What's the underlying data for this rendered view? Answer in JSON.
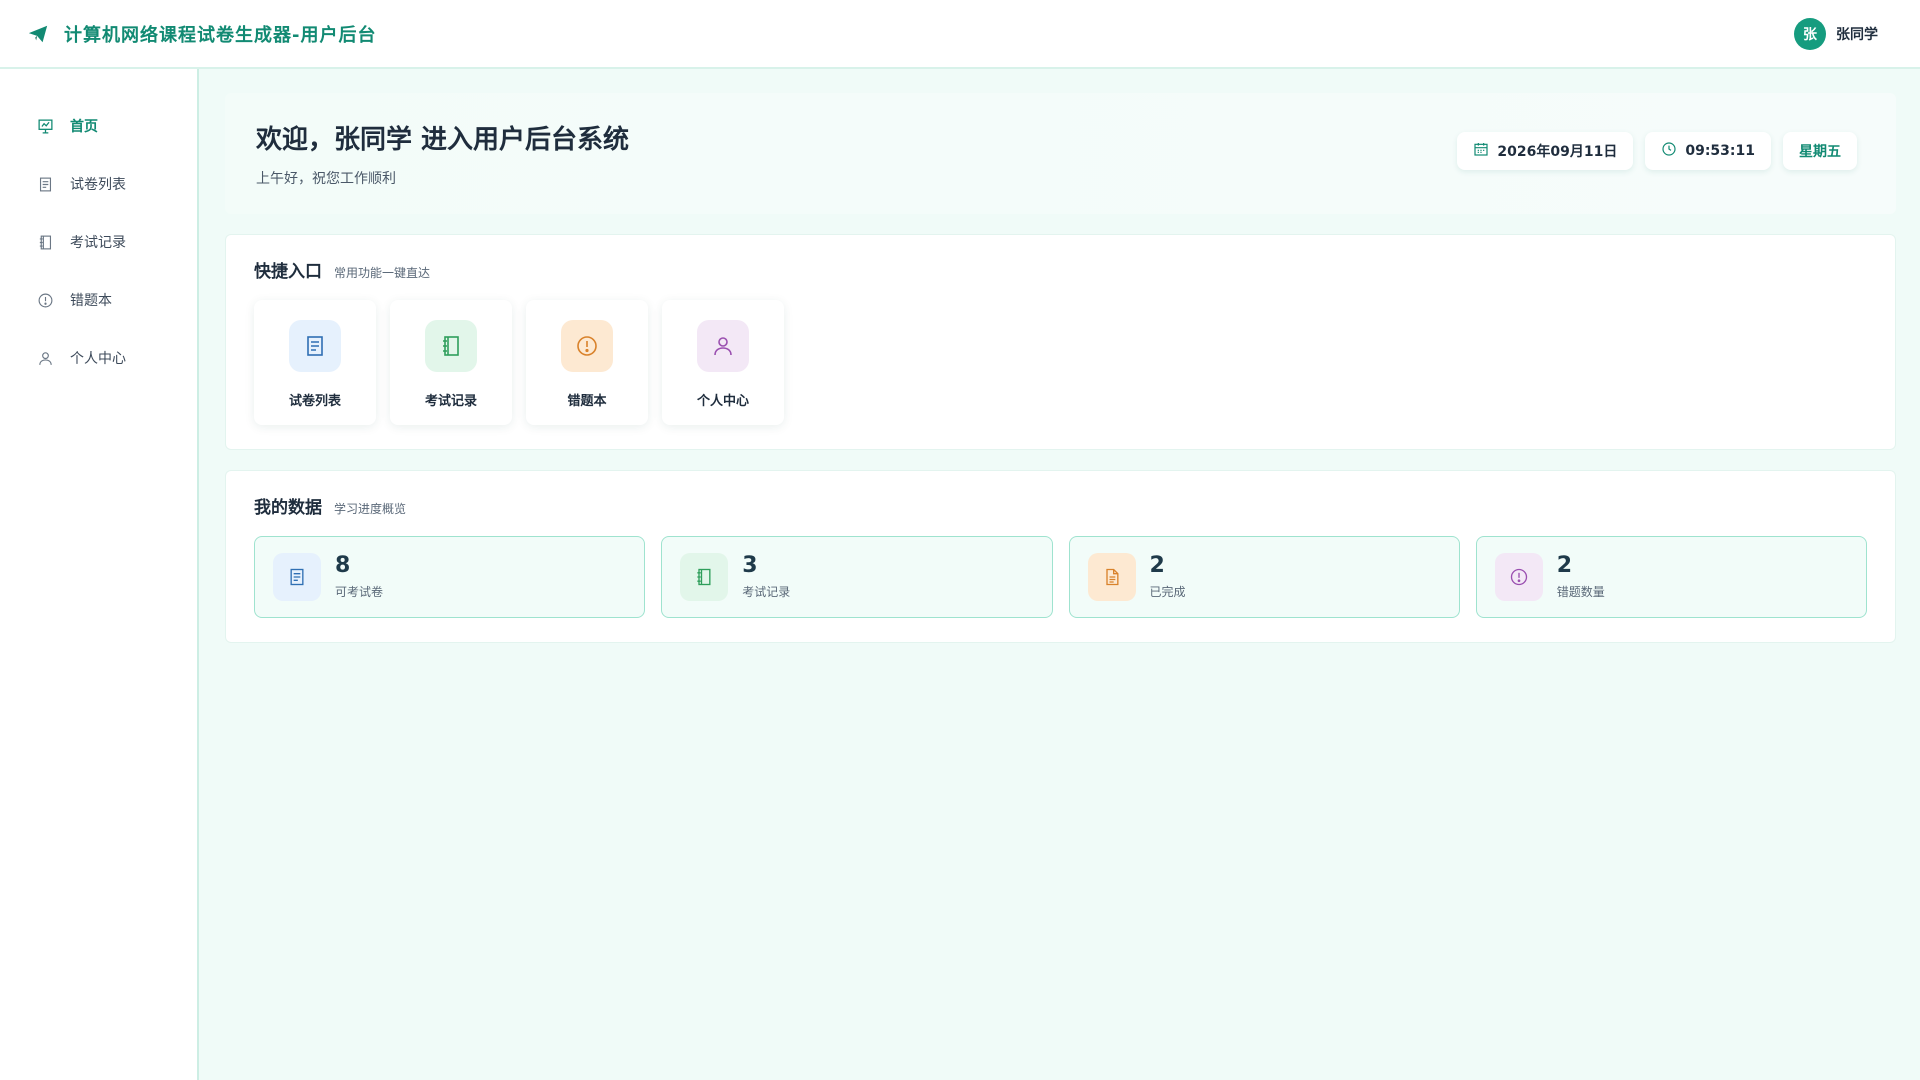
{
  "header": {
    "brand_title": "计算机网络课程试卷生成器-用户后台",
    "user": {
      "avatar_text": "张",
      "name": "张同学"
    }
  },
  "sidebar": {
    "items": [
      {
        "label": "首页",
        "icon": "presentation-chart-icon",
        "active": true
      },
      {
        "label": "试卷列表",
        "icon": "document-icon",
        "active": false
      },
      {
        "label": "考试记录",
        "icon": "notebook-icon",
        "active": false
      },
      {
        "label": "错题本",
        "icon": "alert-circle-icon",
        "active": false
      },
      {
        "label": "个人中心",
        "icon": "user-icon",
        "active": false
      }
    ]
  },
  "welcome": {
    "title": "欢迎，张同学 进入用户后台系统",
    "subtitle": "上午好，祝您工作顺利",
    "date": "2026年09月11日",
    "time": "09:53:11",
    "weekday": "星期五"
  },
  "quick": {
    "title": "快捷入口",
    "subtitle": "常用功能一键直达",
    "items": [
      {
        "label": "试卷列表",
        "icon": "document-icon",
        "color": "#2f6fb3"
      },
      {
        "label": "考试记录",
        "icon": "notebook-icon",
        "color": "#2e9e5b"
      },
      {
        "label": "错题本",
        "icon": "alert-circle-icon",
        "color": "#d9822b"
      },
      {
        "label": "个人中心",
        "icon": "user-icon",
        "color": "#9a4fb0"
      }
    ]
  },
  "stats": {
    "title": "我的数据",
    "subtitle": "学习进度概览",
    "items": [
      {
        "value": "8",
        "label": "可考试卷",
        "icon": "document-icon",
        "color": "#2f6fb3"
      },
      {
        "value": "3",
        "label": "考试记录",
        "icon": "notebook-icon",
        "color": "#2e9e5b"
      },
      {
        "value": "2",
        "label": "已完成",
        "icon": "file-text-icon",
        "color": "#d9822b"
      },
      {
        "value": "2",
        "label": "错题数量",
        "icon": "alert-circle-icon",
        "color": "#9a4fb0"
      }
    ]
  },
  "colors": {
    "accent": "#128a73",
    "background": "#f0fbf8",
    "stat_border": "#9fe3cf"
  }
}
